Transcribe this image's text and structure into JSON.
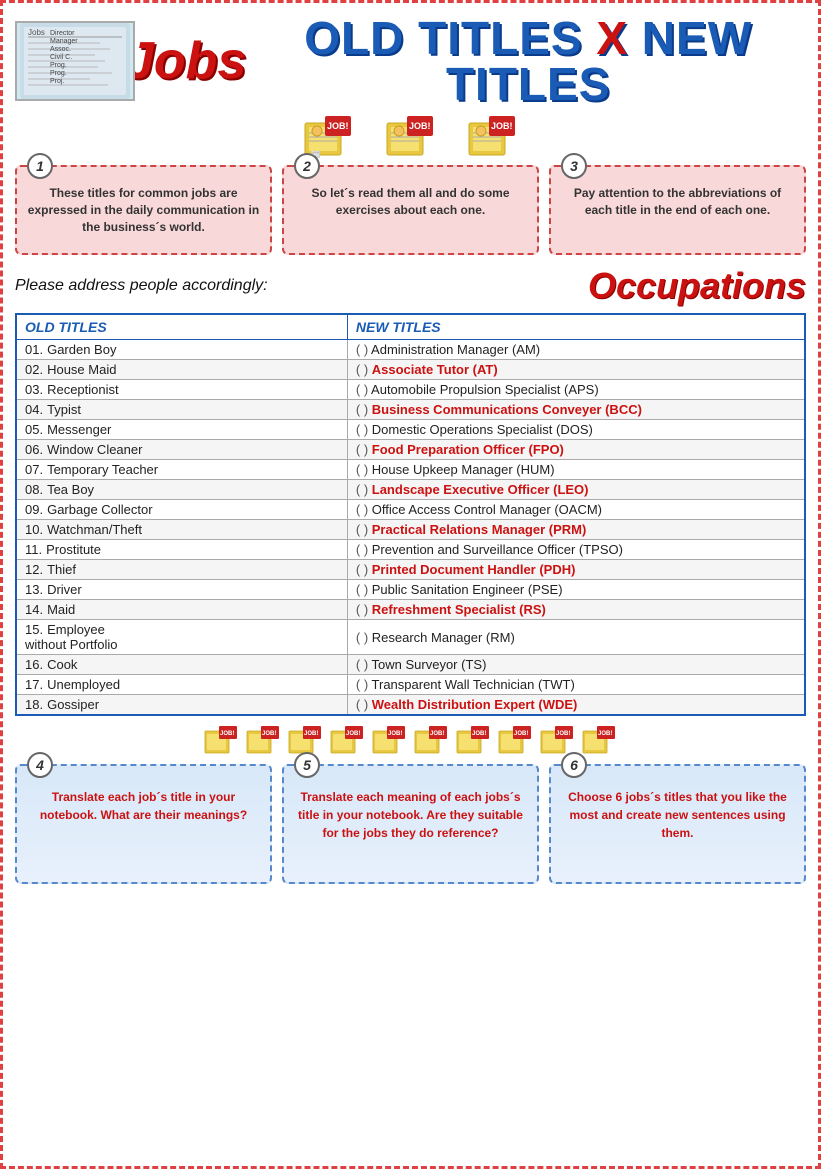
{
  "header": {
    "jobs_label": "Jobs",
    "title": "OLD TITLES X NEW TITLES",
    "x_label": "X"
  },
  "instructions": [
    {
      "num": "1",
      "text": "These titles for common jobs are expressed in the daily communication in the business´s world."
    },
    {
      "num": "2",
      "text": "So let´s read them all and do some exercises about each one."
    },
    {
      "num": "3",
      "text": "Pay attention to the abbreviations of each title in the end of each one."
    }
  ],
  "address_label": "Please address people accordingly:",
  "occupations_label": "Occupations",
  "table": {
    "col1_header": "OLD TITLES",
    "col2_header": "NEW TITLES",
    "rows": [
      {
        "num": "01.",
        "old": "Garden Boy",
        "bracket": "(     )",
        "new": "Administration Manager (AM)",
        "red": false
      },
      {
        "num": "02.",
        "old": "House Maid",
        "bracket": "(     )",
        "new": "Associate Tutor (AT)",
        "red": true
      },
      {
        "num": "03.",
        "old": "Receptionist",
        "bracket": "(     )",
        "new": "Automobile Propulsion Specialist (APS)",
        "red": false
      },
      {
        "num": "04.",
        "old": "Typist",
        "bracket": "(     )",
        "new": "Business Communications Conveyer (BCC)",
        "red": true
      },
      {
        "num": "05.",
        "old": "Messenger",
        "bracket": "(     )",
        "new": "Domestic Operations Specialist (DOS)",
        "red": false
      },
      {
        "num": "06.",
        "old": "Window Cleaner",
        "bracket": "(     )",
        "new": "Food Preparation Officer (FPO)",
        "red": true
      },
      {
        "num": "07.",
        "old": "Temporary Teacher",
        "bracket": "(     )",
        "new": "House Upkeep Manager (HUM)",
        "red": false
      },
      {
        "num": "08.",
        "old": "Tea Boy",
        "bracket": "(     )",
        "new": "Landscape Executive Officer (LEO)",
        "red": true
      },
      {
        "num": "09.",
        "old": "Garbage Collector",
        "bracket": "(     )",
        "new": "Office Access Control Manager (OACM)",
        "red": false
      },
      {
        "num": "10.",
        "old": "Watchman/Theft",
        "bracket": "(     )",
        "new": "Practical  Relations Manager (PRM)",
        "red": true
      },
      {
        "num": "11.",
        "old": "Prostitute",
        "bracket": "(     )",
        "new": "Prevention and Surveillance Officer (TPSO)",
        "red": false
      },
      {
        "num": "12.",
        "old": "Thief",
        "bracket": "(     )",
        "new": "Printed Document Handler (PDH)",
        "red": true
      },
      {
        "num": "13.",
        "old": "Driver",
        "bracket": "(     )",
        "new": "Public Sanitation Engineer (PSE)",
        "red": false
      },
      {
        "num": "14.",
        "old": "Maid",
        "bracket": "(     )",
        "new": "Refreshment Specialist (RS)",
        "red": true
      },
      {
        "num": "15.",
        "old": "Employee\nwithout Portfolio",
        "bracket": "(     )",
        "new": "Research Manager (RM)",
        "red": false
      },
      {
        "num": "16.",
        "old": "Cook",
        "bracket": "(     )",
        "new": "Town Surveyor (TS)",
        "red": false
      },
      {
        "num": "17.",
        "old": "Unemployed",
        "bracket": "(     )",
        "new": "Transparent Wall Technician (TWT)",
        "red": false
      },
      {
        "num": "18.",
        "old": "Gossiper",
        "bracket": "(     )",
        "new": "Wealth Distribution Expert (WDE)",
        "red": true
      }
    ]
  },
  "bottom_instructions": [
    {
      "num": "4",
      "text": "Translate each job´s title in your notebook. What are their meanings?"
    },
    {
      "num": "5",
      "text": "Translate each meaning of each jobs´s title in your notebook. Are they suitable for the jobs they do reference?"
    },
    {
      "num": "6",
      "text": "Choose 6 jobs´s titles that you like the most and create new sentences using them."
    }
  ]
}
